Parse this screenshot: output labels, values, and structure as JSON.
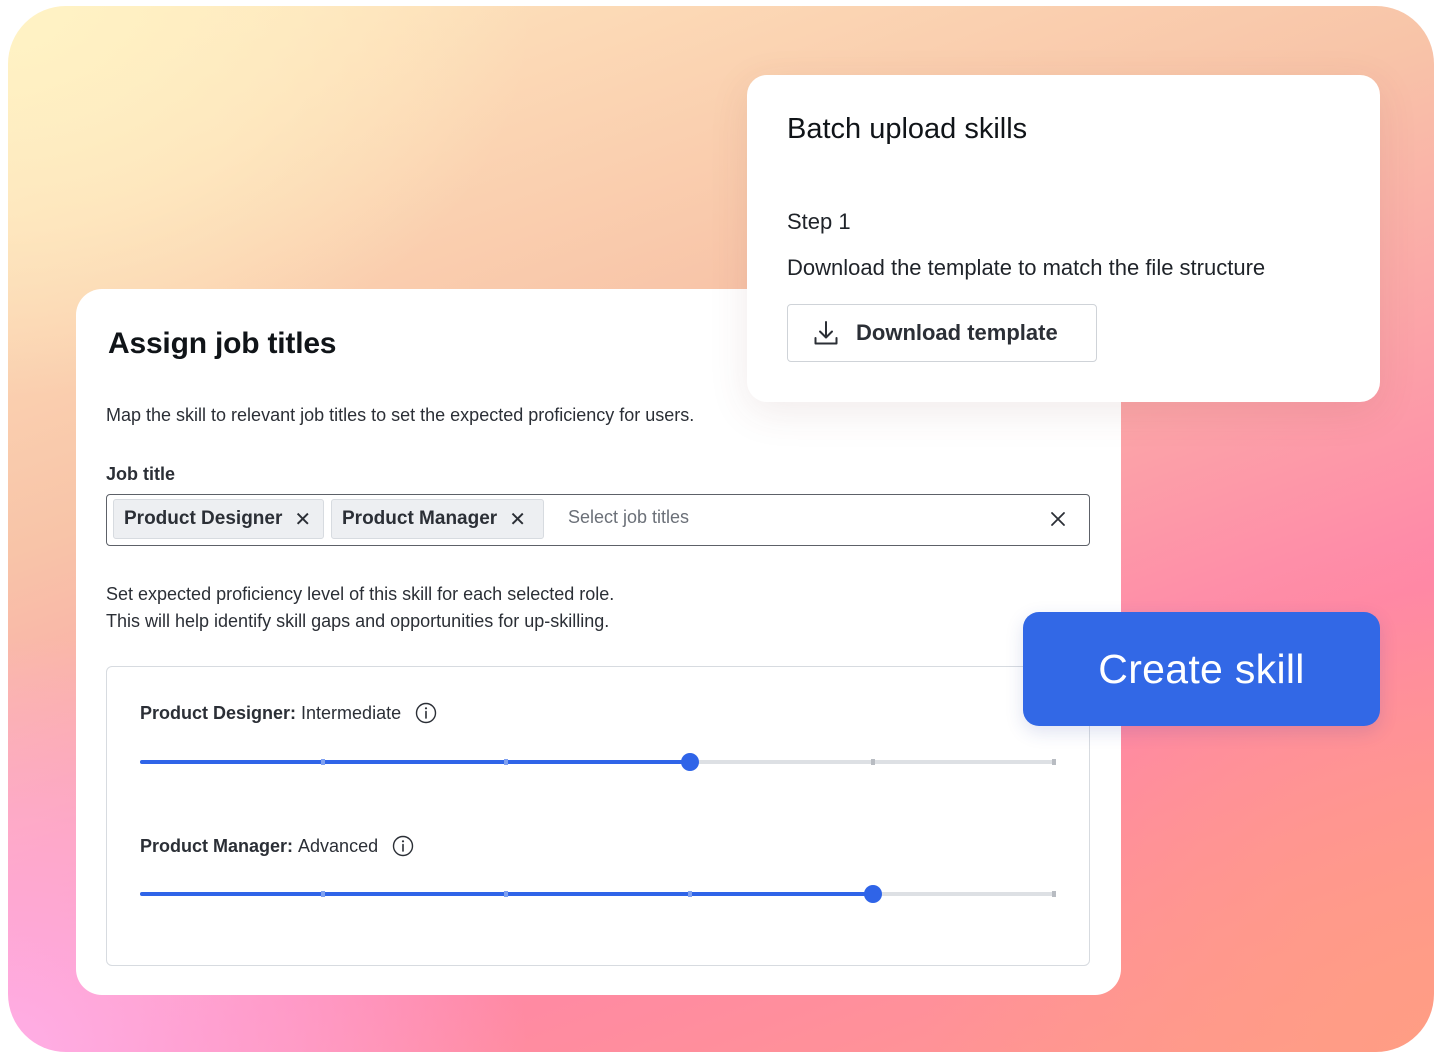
{
  "assign": {
    "title": "Assign job titles",
    "description": "Map the skill to relevant job titles to set the expected proficiency for users.",
    "job_title_label": "Job title",
    "chips": [
      {
        "label": "Product Designer",
        "remove": "✕"
      },
      {
        "label": "Product Manager",
        "remove": "✕"
      }
    ],
    "placeholder": "Select job titles",
    "proficiency_line1": "Set expected proficiency level of this skill for each selected role.",
    "proficiency_line2": "This will help identify skill gaps and opportunities for up-skilling.",
    "roles": [
      {
        "name": "Product Designer:",
        "level": "Intermediate",
        "value_fraction": 0.6
      },
      {
        "name": "Product Manager:",
        "level": "Advanced",
        "value_fraction": 0.8
      }
    ]
  },
  "batch": {
    "title": "Batch upload skills",
    "step_label": "Step 1",
    "step_desc": "Download the template to match the file structure",
    "download_label": "Download template"
  },
  "create_button": {
    "label": "Create skill"
  },
  "colors": {
    "accent": "#3268e6",
    "slider_fill": "#2f64e8",
    "track": "#dde0e4"
  },
  "icons": {
    "download": "download-icon",
    "clear": "close-icon",
    "info": "info-icon"
  }
}
